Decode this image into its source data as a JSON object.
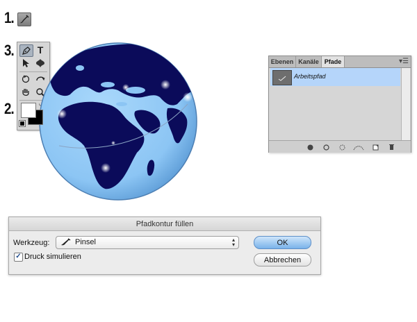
{
  "steps": {
    "one": "1.",
    "two": "2.",
    "three": "3."
  },
  "toolbox": {
    "tools": [
      {
        "name": "pen-tool-icon",
        "glyph": "✒"
      },
      {
        "name": "type-tool-icon",
        "glyph": "T"
      },
      {
        "name": "path-selection-icon",
        "glyph": "➤"
      },
      {
        "name": "custom-shape-icon",
        "glyph": "✱"
      },
      {
        "name": "3d-rotate-icon",
        "glyph": "↻"
      },
      {
        "name": "3d-orbit-icon",
        "glyph": "↺"
      },
      {
        "name": "hand-tool-icon",
        "glyph": "✋"
      },
      {
        "name": "zoom-tool-icon",
        "glyph": "⚲"
      }
    ],
    "foreground_color": "#ffffff",
    "background_color": "#000000"
  },
  "globe": {
    "ocean_color": "#8ec8f7",
    "land_color": "#0c0c5e"
  },
  "panel": {
    "tabs": [
      "Ebenen",
      "Kanäle",
      "Pfade"
    ],
    "active_tab": "Pfade",
    "menu_icon": "panel-menu-icon",
    "path_name": "Arbeitspfad",
    "footer_icons": [
      "fill-path-icon",
      "stroke-path-icon",
      "load-selection-icon",
      "make-work-path-icon",
      "new-path-icon",
      "delete-path-icon"
    ]
  },
  "dialog": {
    "title": "Pfadkontur füllen",
    "tool_label": "Werkzeug:",
    "tool_value": "Pinsel",
    "checkbox_label": "Druck simulieren",
    "checkbox_checked": true,
    "ok_label": "OK",
    "cancel_label": "Abbrechen"
  }
}
